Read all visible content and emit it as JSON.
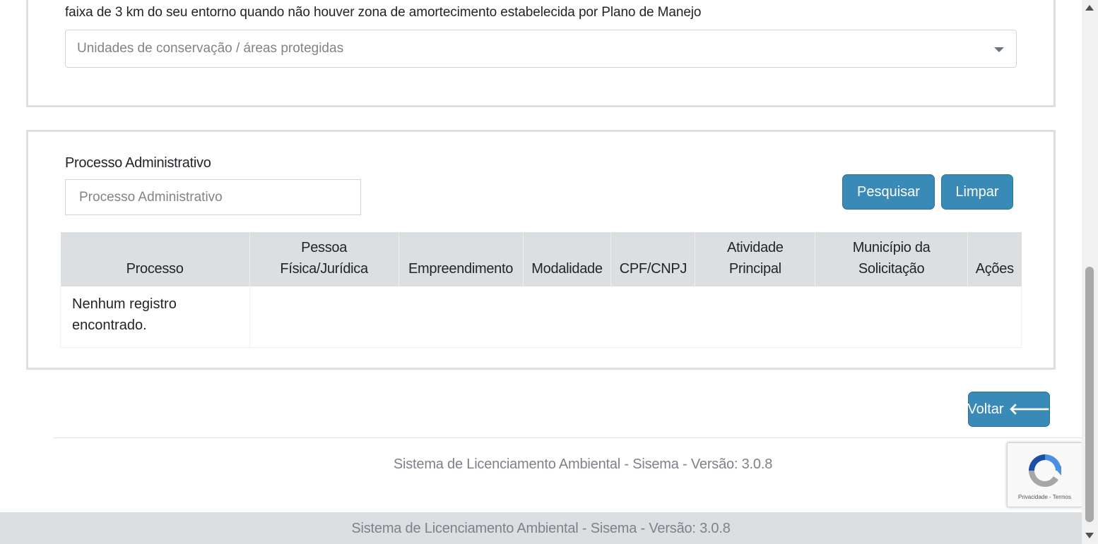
{
  "unidades_conservacao": {
    "label": "faixa de 3 km do seu entorno quando não houver zona de amortecimento estabelecida por Plano de Manejo",
    "select_placeholder": "Unidades de conservação / áreas protegidas"
  },
  "search": {
    "label": "Processo Administrativo",
    "input_placeholder": "Processo Administrativo",
    "input_value": "",
    "pesquisar_label": "Pesquisar",
    "limpar_label": "Limpar"
  },
  "table": {
    "columns": [
      {
        "line1": "",
        "line2": "Processo"
      },
      {
        "line1": "Pessoa",
        "line2": "Física/Jurídica"
      },
      {
        "line1": "",
        "line2": "Empreendimento"
      },
      {
        "line1": "",
        "line2": "Modalidade"
      },
      {
        "line1": "",
        "line2": "CPF/CNPJ"
      },
      {
        "line1": "Atividade",
        "line2": "Principal"
      },
      {
        "line1": "Município da",
        "line2": "Solicitação"
      },
      {
        "line1": "",
        "line2": "Ações"
      }
    ],
    "empty_line1": "Nenhum registro",
    "empty_line2": "encontrado."
  },
  "actions": {
    "voltar_label": "Voltar",
    "voltar_icon": "arrow-left-icon"
  },
  "footer": {
    "text_main": "Sistema de Licenciamento Ambiental - Sisema - Versão: 3.0.8",
    "text_bar": "Sistema de Licenciamento Ambiental - Sisema - Versão: 3.0.8"
  },
  "recaptcha": {
    "links": "Privacidade - Termos",
    "icon": "recaptcha-logo-icon"
  },
  "colors": {
    "primary_button": "#3a8ab8",
    "table_header": "#dcdfe2",
    "footer_bar": "#dcdfe2",
    "footer_text": "#7d828a"
  }
}
